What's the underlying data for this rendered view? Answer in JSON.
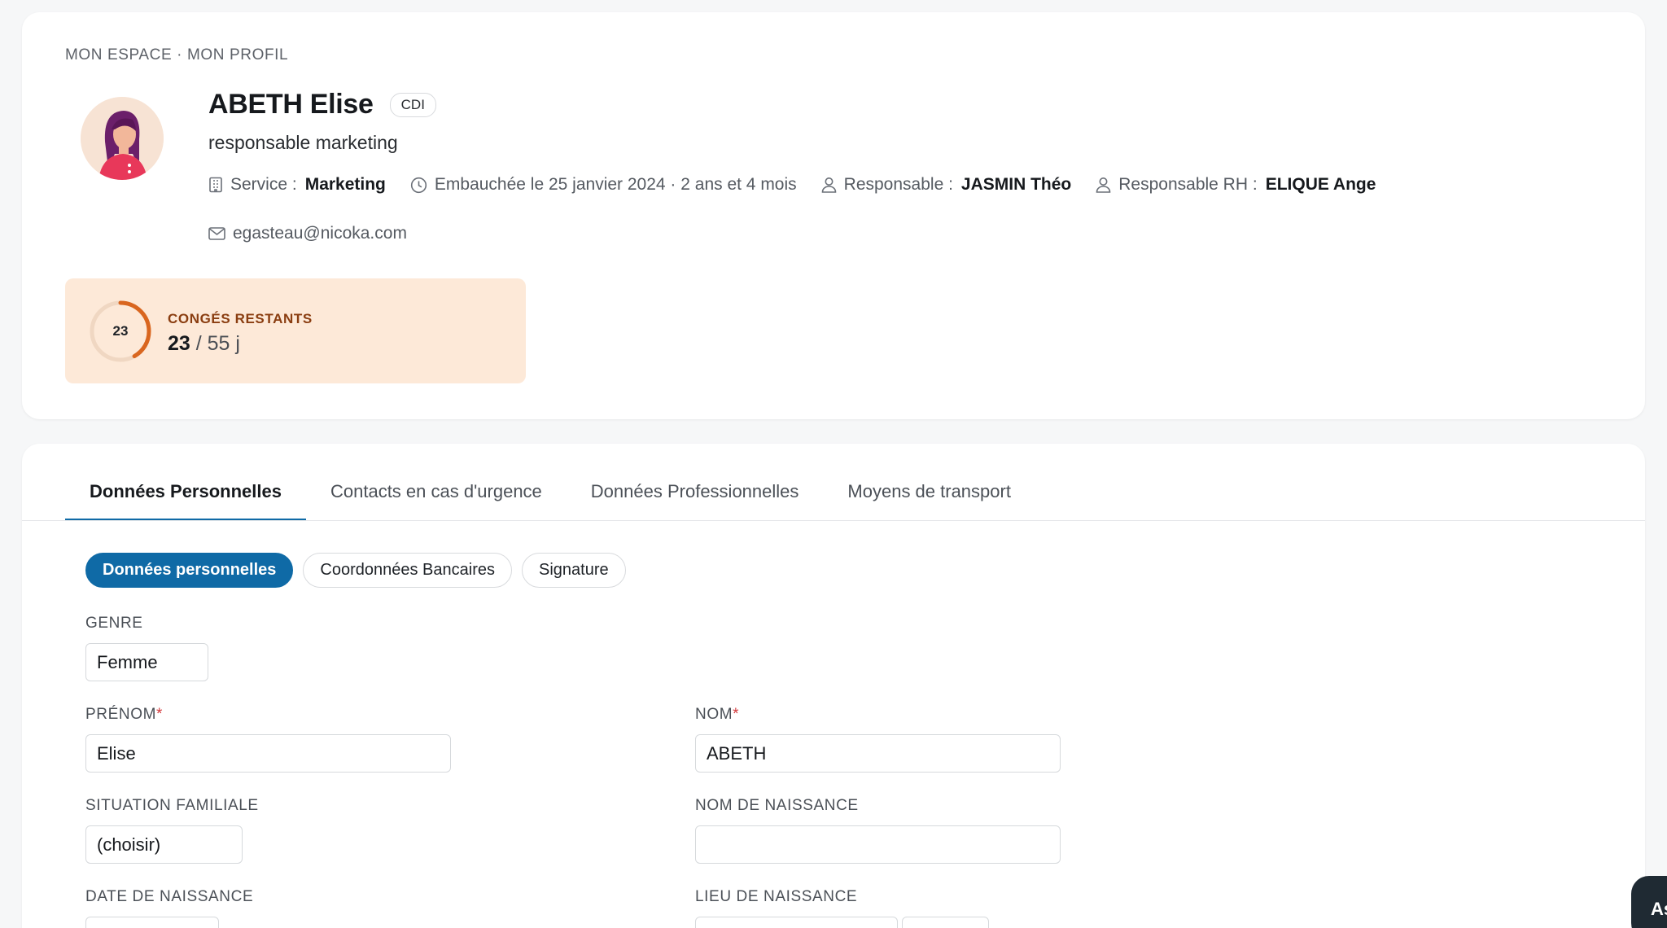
{
  "breadcrumb": "MON ESPACE · MON PROFIL",
  "profile": {
    "name": "ABETH Elise",
    "contract_badge": "CDI",
    "job_title": "responsable marketing",
    "service_label": "Service :",
    "service_value": "Marketing",
    "hired_text": "Embauchée le 25 janvier 2024 · 2 ans et 4 mois",
    "manager_label": "Responsable :",
    "manager_value": "JASMIN Théo",
    "hr_label": "Responsable RH :",
    "hr_value": "ELIQUE Ange",
    "email": "egasteau@nicoka.com"
  },
  "leave": {
    "ring_value": "23",
    "title": "CONGÉS RESTANTS",
    "remaining": "23",
    "total": "/ 55 j",
    "remaining_fraction": 0.418
  },
  "tabs": [
    {
      "label": "Données Personnelles",
      "active": true
    },
    {
      "label": "Contacts en cas d'urgence",
      "active": false
    },
    {
      "label": "Données Professionnelles",
      "active": false
    },
    {
      "label": "Moyens de transport",
      "active": false
    }
  ],
  "subtabs": [
    {
      "label": "Données personnelles",
      "active": true
    },
    {
      "label": "Coordonnées Bancaires",
      "active": false
    },
    {
      "label": "Signature",
      "active": false
    }
  ],
  "form": {
    "genre_label": "GENRE",
    "genre_value": "Femme",
    "prenom_label": "PRÉNOM",
    "prenom_value": "Elise",
    "nom_label": "NOM",
    "nom_value": "ABETH",
    "required_mark": "*",
    "situation_label": "SITUATION FAMILIALE",
    "situation_value": "(choisir)",
    "nom_naissance_label": "NOM DE NAISSANCE",
    "nom_naissance_value": "",
    "date_naissance_label": "DATE DE NAISSANCE",
    "lieu_naissance_label": "LIEU DE NAISSANCE"
  },
  "assistant_button": "As",
  "colors": {
    "accent": "#0f6aa6",
    "leave_bg": "#fde9d8",
    "leave_ring": "#d9661f",
    "leave_title": "#8a3d10",
    "required": "#d3383b"
  },
  "icons": {
    "service": "building-icon",
    "hired": "clock-icon",
    "manager": "user-icon",
    "hr": "user-icon",
    "email": "mail-icon"
  }
}
